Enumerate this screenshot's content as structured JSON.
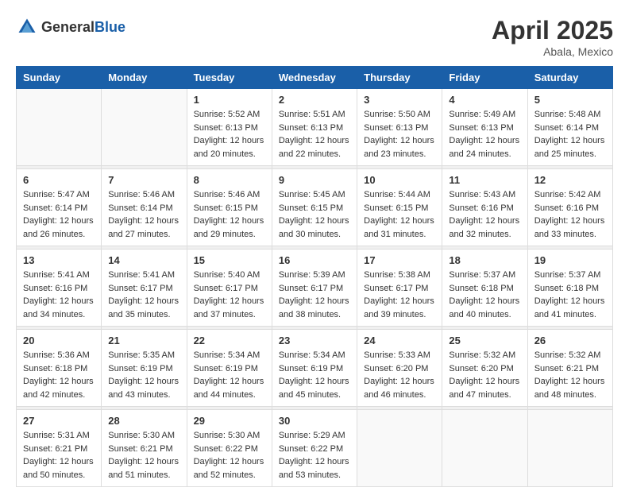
{
  "logo": {
    "text_general": "General",
    "text_blue": "Blue"
  },
  "header": {
    "month_year": "April 2025",
    "location": "Abala, Mexico"
  },
  "weekdays": [
    "Sunday",
    "Monday",
    "Tuesday",
    "Wednesday",
    "Thursday",
    "Friday",
    "Saturday"
  ],
  "weeks": [
    [
      {
        "day": "",
        "info": ""
      },
      {
        "day": "",
        "info": ""
      },
      {
        "day": "1",
        "sunrise": "Sunrise: 5:52 AM",
        "sunset": "Sunset: 6:13 PM",
        "daylight": "Daylight: 12 hours and 20 minutes."
      },
      {
        "day": "2",
        "sunrise": "Sunrise: 5:51 AM",
        "sunset": "Sunset: 6:13 PM",
        "daylight": "Daylight: 12 hours and 22 minutes."
      },
      {
        "day": "3",
        "sunrise": "Sunrise: 5:50 AM",
        "sunset": "Sunset: 6:13 PM",
        "daylight": "Daylight: 12 hours and 23 minutes."
      },
      {
        "day": "4",
        "sunrise": "Sunrise: 5:49 AM",
        "sunset": "Sunset: 6:13 PM",
        "daylight": "Daylight: 12 hours and 24 minutes."
      },
      {
        "day": "5",
        "sunrise": "Sunrise: 5:48 AM",
        "sunset": "Sunset: 6:14 PM",
        "daylight": "Daylight: 12 hours and 25 minutes."
      }
    ],
    [
      {
        "day": "6",
        "sunrise": "Sunrise: 5:47 AM",
        "sunset": "Sunset: 6:14 PM",
        "daylight": "Daylight: 12 hours and 26 minutes."
      },
      {
        "day": "7",
        "sunrise": "Sunrise: 5:46 AM",
        "sunset": "Sunset: 6:14 PM",
        "daylight": "Daylight: 12 hours and 27 minutes."
      },
      {
        "day": "8",
        "sunrise": "Sunrise: 5:46 AM",
        "sunset": "Sunset: 6:15 PM",
        "daylight": "Daylight: 12 hours and 29 minutes."
      },
      {
        "day": "9",
        "sunrise": "Sunrise: 5:45 AM",
        "sunset": "Sunset: 6:15 PM",
        "daylight": "Daylight: 12 hours and 30 minutes."
      },
      {
        "day": "10",
        "sunrise": "Sunrise: 5:44 AM",
        "sunset": "Sunset: 6:15 PM",
        "daylight": "Daylight: 12 hours and 31 minutes."
      },
      {
        "day": "11",
        "sunrise": "Sunrise: 5:43 AM",
        "sunset": "Sunset: 6:16 PM",
        "daylight": "Daylight: 12 hours and 32 minutes."
      },
      {
        "day": "12",
        "sunrise": "Sunrise: 5:42 AM",
        "sunset": "Sunset: 6:16 PM",
        "daylight": "Daylight: 12 hours and 33 minutes."
      }
    ],
    [
      {
        "day": "13",
        "sunrise": "Sunrise: 5:41 AM",
        "sunset": "Sunset: 6:16 PM",
        "daylight": "Daylight: 12 hours and 34 minutes."
      },
      {
        "day": "14",
        "sunrise": "Sunrise: 5:41 AM",
        "sunset": "Sunset: 6:17 PM",
        "daylight": "Daylight: 12 hours and 35 minutes."
      },
      {
        "day": "15",
        "sunrise": "Sunrise: 5:40 AM",
        "sunset": "Sunset: 6:17 PM",
        "daylight": "Daylight: 12 hours and 37 minutes."
      },
      {
        "day": "16",
        "sunrise": "Sunrise: 5:39 AM",
        "sunset": "Sunset: 6:17 PM",
        "daylight": "Daylight: 12 hours and 38 minutes."
      },
      {
        "day": "17",
        "sunrise": "Sunrise: 5:38 AM",
        "sunset": "Sunset: 6:17 PM",
        "daylight": "Daylight: 12 hours and 39 minutes."
      },
      {
        "day": "18",
        "sunrise": "Sunrise: 5:37 AM",
        "sunset": "Sunset: 6:18 PM",
        "daylight": "Daylight: 12 hours and 40 minutes."
      },
      {
        "day": "19",
        "sunrise": "Sunrise: 5:37 AM",
        "sunset": "Sunset: 6:18 PM",
        "daylight": "Daylight: 12 hours and 41 minutes."
      }
    ],
    [
      {
        "day": "20",
        "sunrise": "Sunrise: 5:36 AM",
        "sunset": "Sunset: 6:18 PM",
        "daylight": "Daylight: 12 hours and 42 minutes."
      },
      {
        "day": "21",
        "sunrise": "Sunrise: 5:35 AM",
        "sunset": "Sunset: 6:19 PM",
        "daylight": "Daylight: 12 hours and 43 minutes."
      },
      {
        "day": "22",
        "sunrise": "Sunrise: 5:34 AM",
        "sunset": "Sunset: 6:19 PM",
        "daylight": "Daylight: 12 hours and 44 minutes."
      },
      {
        "day": "23",
        "sunrise": "Sunrise: 5:34 AM",
        "sunset": "Sunset: 6:19 PM",
        "daylight": "Daylight: 12 hours and 45 minutes."
      },
      {
        "day": "24",
        "sunrise": "Sunrise: 5:33 AM",
        "sunset": "Sunset: 6:20 PM",
        "daylight": "Daylight: 12 hours and 46 minutes."
      },
      {
        "day": "25",
        "sunrise": "Sunrise: 5:32 AM",
        "sunset": "Sunset: 6:20 PM",
        "daylight": "Daylight: 12 hours and 47 minutes."
      },
      {
        "day": "26",
        "sunrise": "Sunrise: 5:32 AM",
        "sunset": "Sunset: 6:21 PM",
        "daylight": "Daylight: 12 hours and 48 minutes."
      }
    ],
    [
      {
        "day": "27",
        "sunrise": "Sunrise: 5:31 AM",
        "sunset": "Sunset: 6:21 PM",
        "daylight": "Daylight: 12 hours and 50 minutes."
      },
      {
        "day": "28",
        "sunrise": "Sunrise: 5:30 AM",
        "sunset": "Sunset: 6:21 PM",
        "daylight": "Daylight: 12 hours and 51 minutes."
      },
      {
        "day": "29",
        "sunrise": "Sunrise: 5:30 AM",
        "sunset": "Sunset: 6:22 PM",
        "daylight": "Daylight: 12 hours and 52 minutes."
      },
      {
        "day": "30",
        "sunrise": "Sunrise: 5:29 AM",
        "sunset": "Sunset: 6:22 PM",
        "daylight": "Daylight: 12 hours and 53 minutes."
      },
      {
        "day": "",
        "info": ""
      },
      {
        "day": "",
        "info": ""
      },
      {
        "day": "",
        "info": ""
      }
    ]
  ]
}
